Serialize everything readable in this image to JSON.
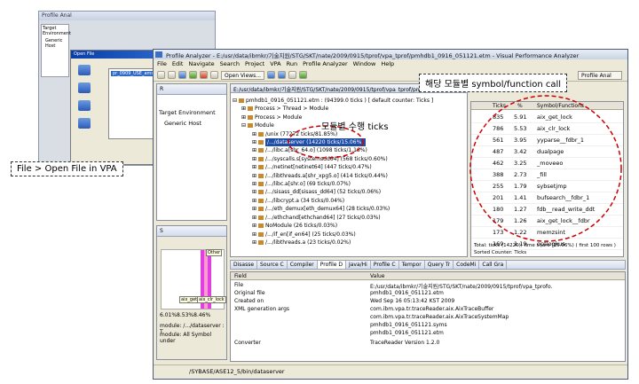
{
  "bg_window": {
    "title": "Profile Anal",
    "view_label": "Open Views",
    "target_env": "Target Environment",
    "generic_host": "Generic Host",
    "open_dialog": {
      "title": "Open File",
      "file": "pr_0909_USE_ams_tesi"
    }
  },
  "main": {
    "title": "Profile Analyzer - E:/usr/data/ibmkr/기술지원/STG/SKT/nate/2009/0915/tprof/vpa_tprof/pmhdb1_0916_051121.etm - Visual Performance Analyzer",
    "menu": [
      "File",
      "Edit",
      "Navigate",
      "Search",
      "Project",
      "VPA",
      "Run",
      "Profile Analyzer",
      "Window",
      "Help"
    ],
    "open_views": "Open Views...",
    "perspective": "Profile Anal",
    "left_tab": "R",
    "left_target_env": "Target Environment",
    "left_generic_host": "Generic Host",
    "left_bottom_tab": "S",
    "bar_labels": [
      "Other",
      "aix_get",
      "aix_clr_lock"
    ],
    "bar_status": "6.01%8.53%8.46%",
    "module_line1": "module: /.../dataserver : T",
    "module_line2": "module: All Symbol under",
    "path": "E:/usr/data/ibmkr/기술지원/STG/SKT/nate/2009/0915/tprof/vpa_tprof/pmhdb1_0916_051121.etm",
    "tree": [
      "pmhdb1_0916_051121.etm : (94399.0 ticks ) [ default counter: Ticks ]",
      "Process > Thread > Module",
      "Process > Module",
      "Module",
      "/unix (77272 ticks/81.85%)",
      "/.../dataserver (14220 ticks/15.06%)",
      "/.../libc.a[shr_64.o] (1098 ticks/1.16%)",
      "/.../syscalls.s[systemsdd64] (568 ticks/0.60%)",
      "/.../netinet[netinet64] (447 ticks/0.47%)",
      "/.../libthreads.a[shr_xpg5.o] (414 ticks/0.44%)",
      "/.../libc.a[shr.o] (69 ticks/0.07%)",
      "/.../sisass_dd[sisass_dd64] (52 ticks/0.06%)",
      "/.../libcrypt.a (34 ticks/0.04%)",
      "/.../eth_demux[eth_demux64] (28 ticks/0.03%)",
      "/.../ethchand[ethchand64] (27 ticks/0.03%)",
      "NoModule (26 ticks/0.03%)",
      "/.../if_en[if_en64] (25 ticks/0.03%)",
      "/.../libthreads.a (23 ticks/0.02%)"
    ],
    "sym_cols": {
      "ticks": "Ticks",
      "pct": "%",
      "symbol": "Symbol/Functions"
    },
    "sym_rows": [
      {
        "ticks": "835",
        "pct": "5.91",
        "symbol": "aix_get_lock"
      },
      {
        "ticks": "786",
        "pct": "5.53",
        "symbol": "aix_clr_lock"
      },
      {
        "ticks": "561",
        "pct": "3.95",
        "symbol": "yyparse__fdbr_1"
      },
      {
        "ticks": "487",
        "pct": "3.42",
        "symbol": "dualpage"
      },
      {
        "ticks": "462",
        "pct": "3.25",
        "symbol": "_moveeo"
      },
      {
        "ticks": "388",
        "pct": "2.73",
        "symbol": "_fill"
      },
      {
        "ticks": "255",
        "pct": "1.79",
        "symbol": "sybsetjmp"
      },
      {
        "ticks": "201",
        "pct": "1.41",
        "symbol": "bufsearch__fdbr_1"
      },
      {
        "ticks": "180",
        "pct": "1.27",
        "symbol": "fdb__read_write_ddt"
      },
      {
        "ticks": "179",
        "pct": "1.26",
        "symbol": "aix_get_lock__fdbr"
      },
      {
        "ticks": "173",
        "pct": "1.22",
        "symbol": "memzsint"
      },
      {
        "ticks": "169",
        "pct": "1.19",
        "symbol": "optlogkus"
      },
      {
        "ticks": "141",
        "pct": "0.99",
        "symbol": "get_system_table"
      }
    ],
    "sym_footer1": "Total: ticks (14220); time share (15.06%) ( first 100 rows )",
    "sym_footer2": "Sorted Counter: Ticks",
    "tabs": [
      "Disasse",
      "Source C",
      "Compiler",
      "Profile D",
      "Java/Hi",
      "Profile C",
      "Tempor",
      "Query Tr",
      "CodeMi",
      "Call Gra"
    ],
    "active_tab": 3,
    "props_head": {
      "field": "Field",
      "value": "Value"
    },
    "props": [
      {
        "field": "File",
        "value": "E:/usr/data/ibmkr/기술지원/STG/SKT/nate/2009/0915/tprof/vpa_tprofo."
      },
      {
        "field": "Original file",
        "value": "pmhdb1_0916_051121.etm"
      },
      {
        "field": "Created on",
        "value": "Wed Sep 16 05:13:42 KST 2009"
      },
      {
        "field": "XML generation args",
        "value": "com.ibm.vpa.tr.traceReader.aix.AixTraceBuffer"
      },
      {
        "field": "",
        "value": "com.ibm.vpa.tr.traceReader.aix.AixTraceSystemMap"
      },
      {
        "field": "",
        "value": "pmhdb1_0916_051121.syms"
      },
      {
        "field": "",
        "value": "pmhdb1_0916_051121.etm"
      },
      {
        "field": "Converter",
        "value": "TraceReader Version 1.2.0"
      }
    ],
    "statusbar": "/SYBASE/ASE12_5/bin/dataserver"
  },
  "annotations": {
    "open_file": "File > Open File in VPA",
    "sym_call": "해당 모듈별 symbol/function call",
    "module_ticks": "모듈별 수행 ticks"
  },
  "colors": {
    "accent": "#1f4ea8",
    "bar": "#e040e0",
    "annotation": "#cc0000"
  }
}
